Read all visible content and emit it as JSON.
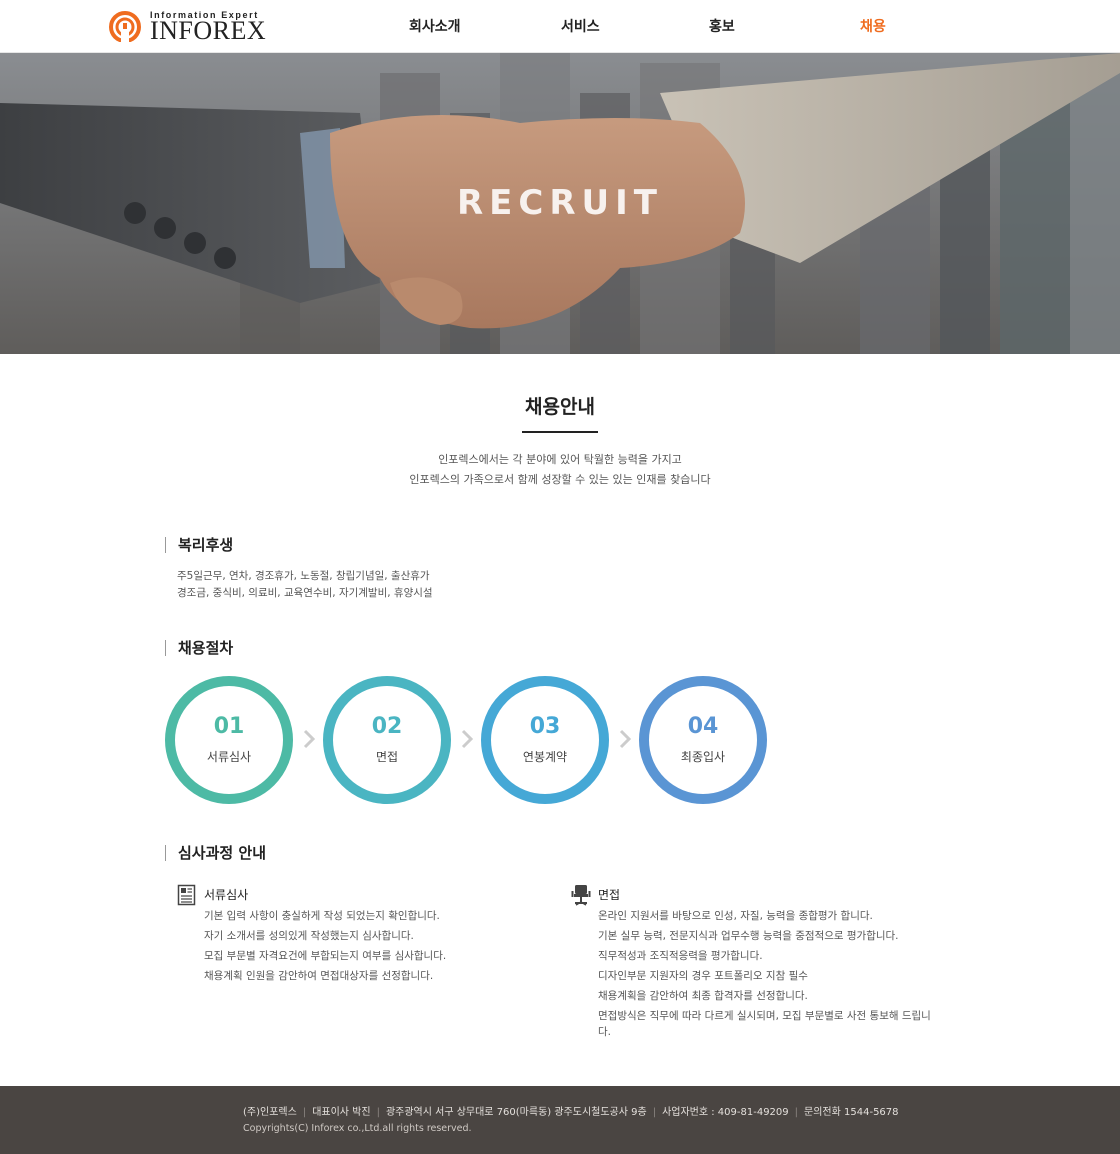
{
  "header": {
    "logo_tagline": "Information Expert",
    "logo_text": "INFOREX",
    "nav": [
      {
        "label": "회사소개",
        "active": false
      },
      {
        "label": "서비스",
        "active": false
      },
      {
        "label": "홍보",
        "active": false
      },
      {
        "label": "채용",
        "active": true
      }
    ],
    "accent_color": "#ef6c1f"
  },
  "hero": {
    "title": "RECRUIT"
  },
  "main": {
    "title": "채용안내",
    "intro": [
      "인포렉스에서는 각 분야에 있어 탁월한 능력을 가지고",
      "인포렉스의 가족으로서 함께 성장할 수 있는 있는 인재를 찾습니다"
    ],
    "welfare": {
      "heading": "복리후생",
      "lines": [
        "주5일근무, 연차, 경조휴가, 노동절, 창립기념일, 출산휴가",
        "경조금, 중식비, 의료비, 교육연수비, 자기계발비, 휴양시설"
      ]
    },
    "process": {
      "heading": "채용절차",
      "steps": [
        {
          "number": "01",
          "label": "서류심사",
          "color": "#4dbaa5"
        },
        {
          "number": "02",
          "label": "면접",
          "color": "#4ab5c2"
        },
        {
          "number": "03",
          "label": "연봉계약",
          "color": "#45a8d6"
        },
        {
          "number": "04",
          "label": "최종입사",
          "color": "#5a95d4"
        }
      ]
    },
    "review": {
      "heading": "심사과정 안내",
      "columns": [
        {
          "icon": "document-icon",
          "title": "서류심사",
          "lines": [
            "기본 입력 사항이 충실하게 작성 되었는지 확인합니다.",
            "자기 소개서를 성의있게 작성했는지 심사합니다.",
            "모집 부문별 자격요건에 부합되는지 여부를 심사합니다.",
            "채용계획 인원을 감안하여 면접대상자를 선정합니다."
          ]
        },
        {
          "icon": "chair-icon",
          "title": "면접",
          "lines": [
            "온라인 지원서를 바탕으로 인성, 자질, 능력을 종합평가 합니다.",
            "기본 실무 능력, 전문지식과 업무수행 능력을 중점적으로 평가합니다.",
            "직무적성과 조직적응력을 평가합니다.",
            "디자인부문 지원자의 경우 포트폴리오 지참 필수",
            "채용계획을 감안하여 최종 합격자를 선정합니다.",
            "면접방식은 직무에 따라 다르게 실시되며, 모집 부문별로 사전 통보해 드립니",
            "다."
          ]
        }
      ]
    }
  },
  "footer": {
    "company": "(주)인포렉스",
    "ceo": "대표이사 박진",
    "address": "광주광역시 서구 상무대로 760(마륵동) 광주도시철도공사 9층",
    "business_no": "사업자번호 : 409-81-49209",
    "phone": "문의전화 1544-5678",
    "copyright": "Copyrights(C) Inforex co.,Ltd.all rights reserved."
  }
}
